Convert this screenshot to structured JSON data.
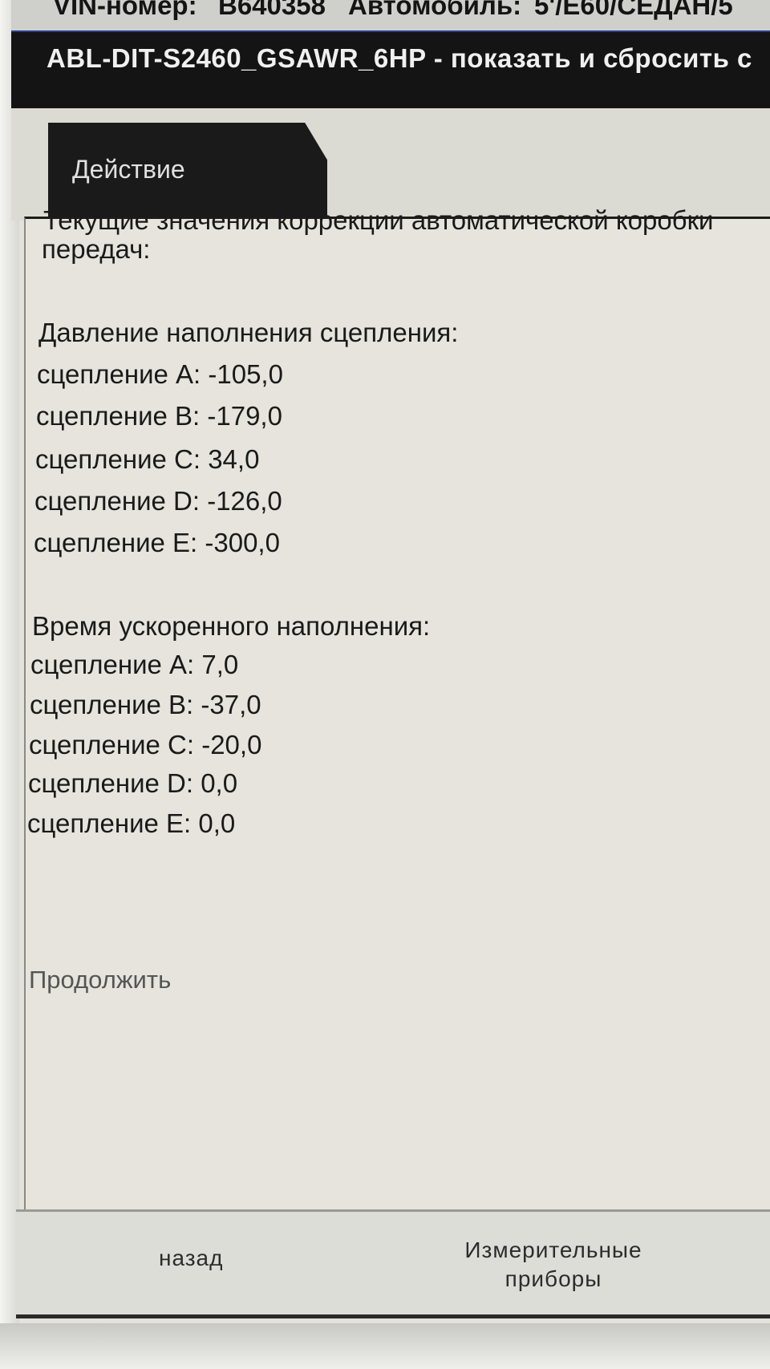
{
  "header": {
    "vin_label": "VIN-номер:",
    "vin_value": "B640358",
    "car_label": "Автомобиль:",
    "car_value": "5'/E60/СЕДАН/5"
  },
  "title": "ABL-DIT-S2460_GSAWR_6HP - показать и сбросить с",
  "tab": {
    "label": "Действие"
  },
  "content": {
    "intro_line1": "Текущие значения коррекции автоматической коробки",
    "intro_line2": "передач:",
    "section1_title": "Давление наполнения сцепления:",
    "section1_items": [
      "сцепление A: -105,0",
      "сцепление B: -179,0",
      "сцепление C: 34,0",
      "сцепление D: -126,0",
      "сцепление E: -300,0"
    ],
    "section2_title": "Время ускоренного наполнения:",
    "section2_items": [
      "сцепление A: 7,0",
      "сцепление B: -37,0",
      "сцепление C: -20,0",
      "сцепление D: 0,0",
      "сцепление E: 0,0"
    ],
    "continue": "Продолжить"
  },
  "footer": {
    "back": "назад",
    "measure_line1": "Измерительные",
    "measure_line2": "приборы"
  }
}
